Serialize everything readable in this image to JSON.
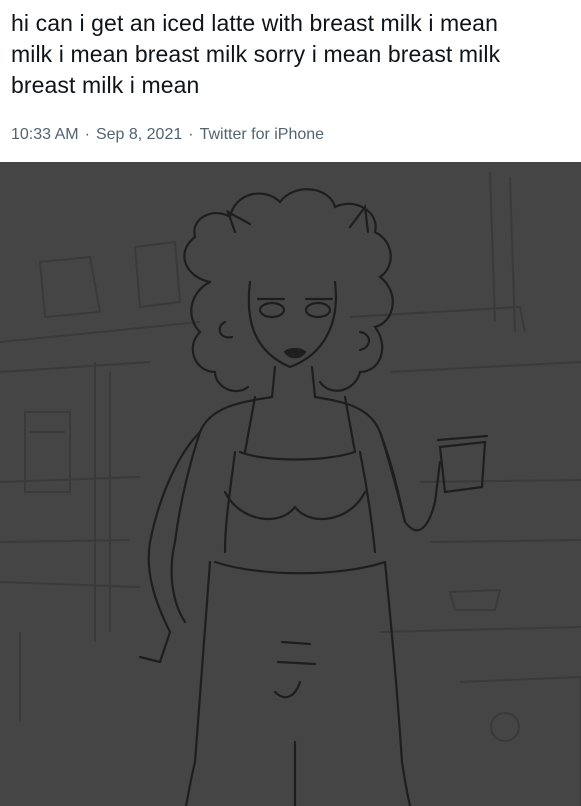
{
  "tweet": {
    "line1": "hi can i get an iced latte with breast milk i mean",
    "line2": "milk i mean breast milk sorry i mean breast milk",
    "line3": "breast milk i mean",
    "time": "10:33 AM",
    "separator1": "·",
    "date": "Sep 8, 2021",
    "separator2": "·",
    "source": "Twitter for iPhone"
  },
  "media": {
    "background_color": "#454545",
    "line_color": "#1e1e1e",
    "faint_line_color": "#3a3a3a"
  }
}
